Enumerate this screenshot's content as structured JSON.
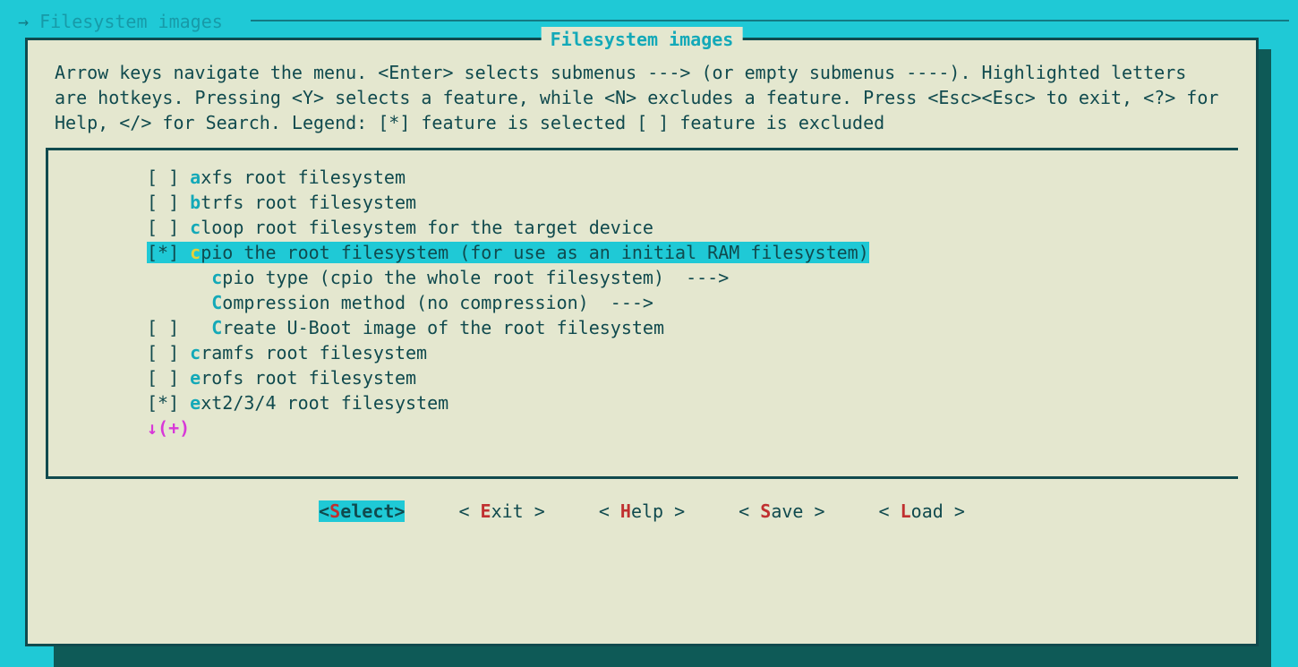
{
  "breadcrumb": "Filesystem images",
  "title": "Filesystem images",
  "help": "Arrow keys navigate the menu.  <Enter> selects submenus ---> (or empty submenus ----). Highlighted letters are hotkeys.  Pressing <Y> selects a feature, while <N> excludes a feature.  Press <Esc><Esc> to exit, <?> for Help, </> for Search.  Legend: [*] feature is selected  [ ] feature is excluded",
  "items": [
    {
      "checkbox": "[ ]",
      "indent": " ",
      "hotkey": "a",
      "rest": "xfs root filesystem",
      "selected": false,
      "highlighted": false,
      "suffix": ""
    },
    {
      "checkbox": "[ ]",
      "indent": " ",
      "hotkey": "b",
      "rest": "trfs root filesystem",
      "selected": false,
      "highlighted": false,
      "suffix": ""
    },
    {
      "checkbox": "[ ]",
      "indent": " ",
      "hotkey": "c",
      "rest": "loop root filesystem for the target device",
      "selected": false,
      "highlighted": false,
      "suffix": ""
    },
    {
      "checkbox": "[*]",
      "indent": " ",
      "hotkey": "c",
      "rest": "pio the root filesystem (for use as an initial RAM filesystem)",
      "selected": true,
      "highlighted": true,
      "suffix": ""
    },
    {
      "checkbox": "   ",
      "indent": "   ",
      "hotkey": "c",
      "rest": "pio type (cpio the whole root filesystem)",
      "selected": false,
      "highlighted": false,
      "suffix": "  --->"
    },
    {
      "checkbox": "   ",
      "indent": "   ",
      "hotkey": "C",
      "rest": "ompression method (no compression)",
      "selected": false,
      "highlighted": false,
      "suffix": "  --->"
    },
    {
      "checkbox": "[ ]",
      "indent": "   ",
      "hotkey": "C",
      "rest": "reate U-Boot image of the root filesystem",
      "selected": false,
      "highlighted": false,
      "suffix": ""
    },
    {
      "checkbox": "[ ]",
      "indent": " ",
      "hotkey": "c",
      "rest": "ramfs root filesystem",
      "selected": false,
      "highlighted": false,
      "suffix": ""
    },
    {
      "checkbox": "[ ]",
      "indent": " ",
      "hotkey": "e",
      "rest": "rofs root filesystem",
      "selected": false,
      "highlighted": false,
      "suffix": ""
    },
    {
      "checkbox": "[*]",
      "indent": " ",
      "hotkey": "e",
      "rest": "xt2/3/4 root filesystem",
      "selected": true,
      "highlighted": false,
      "suffix": ""
    }
  ],
  "more_indicator": "↓(+)",
  "buttons": [
    {
      "pre": "<",
      "hk": "S",
      "post": "elect>",
      "selected": true
    },
    {
      "pre": "< ",
      "hk": "E",
      "post": "xit >",
      "selected": false
    },
    {
      "pre": "< ",
      "hk": "H",
      "post": "elp >",
      "selected": false
    },
    {
      "pre": "< ",
      "hk": "S",
      "post": "ave >",
      "selected": false
    },
    {
      "pre": "< ",
      "hk": "L",
      "post": "oad >",
      "selected": false
    }
  ]
}
